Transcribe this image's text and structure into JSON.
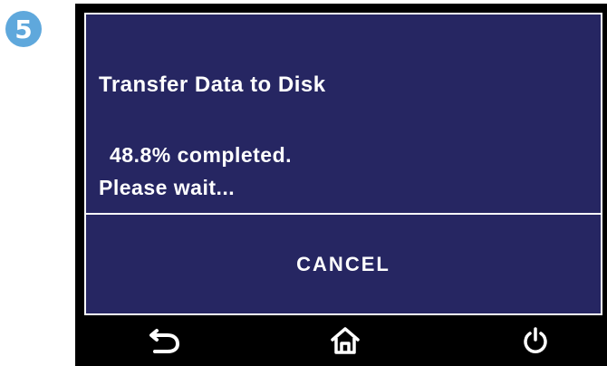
{
  "step_badge": {
    "number": "5",
    "color": "#5fa8dc"
  },
  "screen": {
    "background": "#262662",
    "title": "Transfer Data to Disk",
    "progress_text": "48.8%  completed.",
    "progress_percent": 48.8,
    "wait_text": "Please wait...",
    "cancel_label": "CANCEL"
  },
  "nav": {
    "icons": [
      "back-arrow-icon",
      "home-icon",
      "power-icon"
    ]
  }
}
